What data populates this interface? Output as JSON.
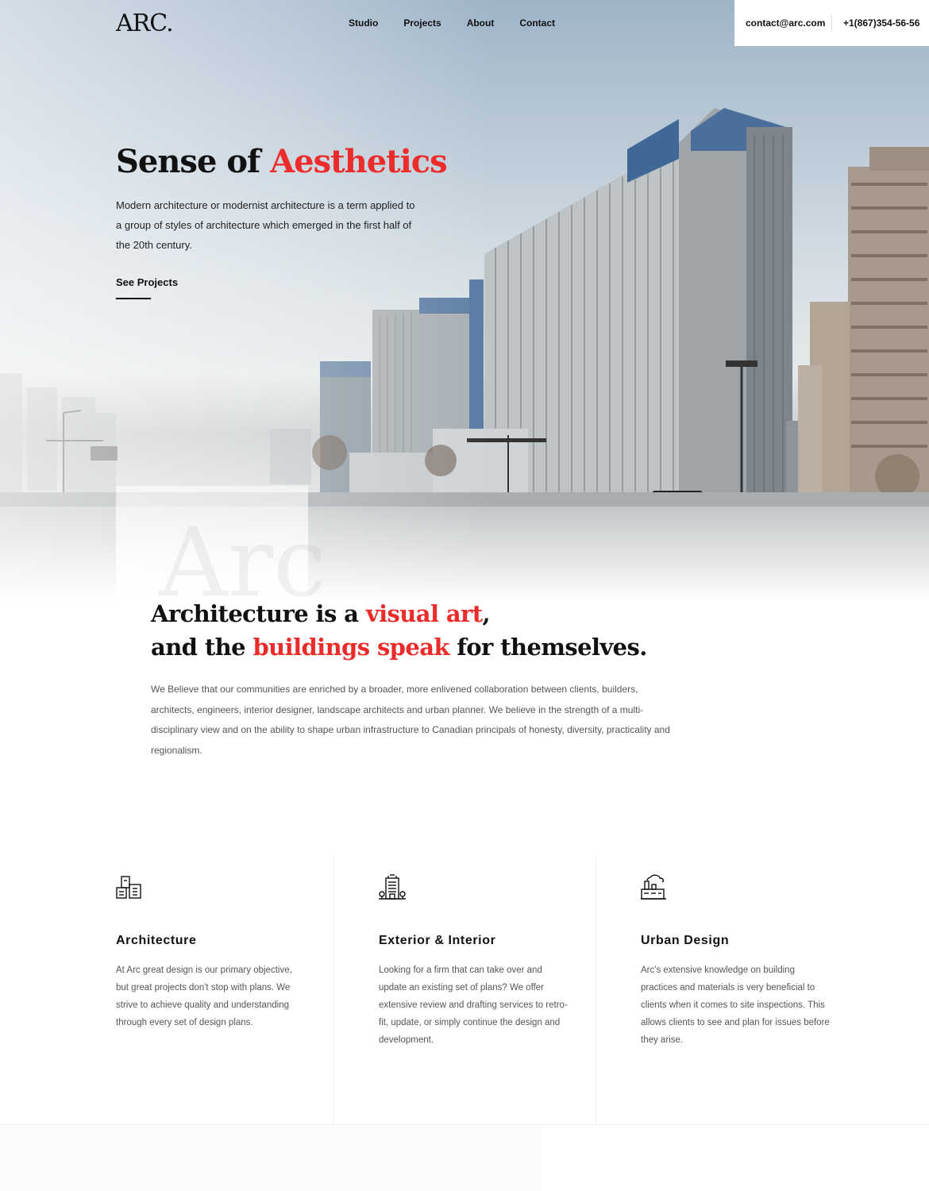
{
  "header": {
    "logo": "ARC.",
    "nav": [
      "Studio",
      "Projects",
      "About",
      "Contact"
    ],
    "email": "contact@arc.com",
    "phone": "+1(867)354-56-56"
  },
  "hero": {
    "title_part1": "Sense of ",
    "title_accent": "Aesthetics",
    "description": "Modern architecture or modernist architecture is a term applied to a group of styles of architecture which emerged in the first half of the 20th century.",
    "cta": "See Projects",
    "watermark": "Arc"
  },
  "intro": {
    "line1_a": "Architecture is a ",
    "line1_accent": "visual art",
    "line1_b": ",",
    "line2_a": "and the ",
    "line2_accent": "buildings speak",
    "line2_b": " for themselves.",
    "text": "We Believe that our communities are enriched by a broader, more enlivened collaboration between clients, builders, architects, engineers, interior designer, landscape architects and urban planner. We believe in the strength of a multi-disciplinary view and on the ability to shape urban infrastructure to Canadian principals of honesty, diversity, practicality and regionalism."
  },
  "services": [
    {
      "icon": "buildings-icon",
      "title": "Architecture",
      "text": "At Arc great design is our primary objective, but great projects don't stop with plans. We strive to achieve quality and understanding through every set of design plans."
    },
    {
      "icon": "office-tower-icon",
      "title": "Exterior & Interior",
      "text": "Looking for a firm that can take over and update an existing set of plans? We offer extensive review and drafting services to retro-fit, update, or simply continue the design and development."
    },
    {
      "icon": "factory-icon",
      "title": "Urban Design",
      "text": "Arc's extensive knowledge on building practices and materials is very beneficial to clients when it comes to site inspections. This allows clients to see and plan for issues before they arise."
    }
  ],
  "colors": {
    "accent": "#ec2b2b",
    "text": "#111111",
    "muted": "#555555"
  }
}
